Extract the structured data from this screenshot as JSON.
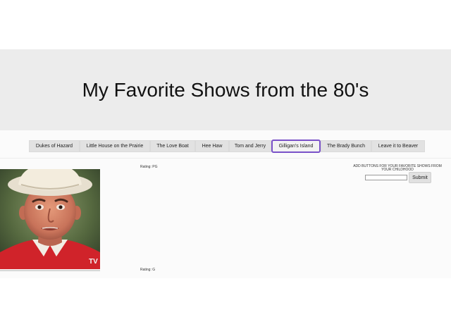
{
  "header": {
    "title": "My Favorite Shows from the 80's"
  },
  "tabs": [
    {
      "label": "Dukes of Hazard",
      "active": false
    },
    {
      "label": "Little House on the Prairie",
      "active": false
    },
    {
      "label": "The Love Boat",
      "active": false
    },
    {
      "label": "Hee Haw",
      "active": false
    },
    {
      "label": "Tom and Jerry",
      "active": false
    },
    {
      "label": "Gilligan's Island",
      "active": true
    },
    {
      "label": "The Brady Bunch",
      "active": false
    },
    {
      "label": "Leave it to Beaver",
      "active": false
    }
  ],
  "main": {
    "image_watermark": "TV",
    "rating_top": "Rating: PG",
    "rating_bottom": "Rating: G"
  },
  "add_form": {
    "label": "ADD BUTTONS FOR YOUR FAVORITE SHOWS FROM YOUR CHILDHOOD",
    "input_value": "",
    "submit_label": "Submit"
  },
  "colors": {
    "active_tab_border": "#7a52c8",
    "hero_background": "#ececec",
    "tab_background": "#e2e2e2"
  }
}
